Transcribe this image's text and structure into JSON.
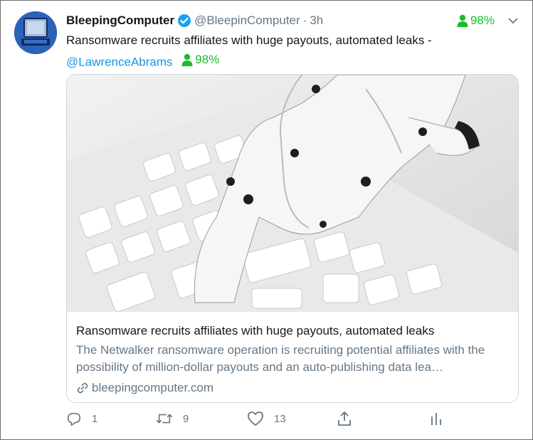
{
  "tweet": {
    "author_name": "BleepingComputer",
    "handle": "@BleepinComputer",
    "separator": "·",
    "time": "3h",
    "score": "98%",
    "text": "Ransomware recruits affiliates with huge payouts, automated leaks -",
    "mention": "@LawrenceAbrams",
    "mention_score": "98%"
  },
  "card": {
    "title": "Ransomware recruits affiliates with huge payouts, automated leaks",
    "description": "The Netwalker ransomware operation is recruiting potential affiliates with the possibility of million-dollar payouts and an auto-publishing data lea…",
    "domain": "bleepingcomputer.com",
    "image_alt": "robot hand pressing keyboard key"
  },
  "actions": {
    "reply_count": "1",
    "retweet_count": "9",
    "like_count": "13"
  },
  "colors": {
    "accent": "#1b95e0",
    "score_green": "#17bf2a",
    "muted": "#657786"
  }
}
